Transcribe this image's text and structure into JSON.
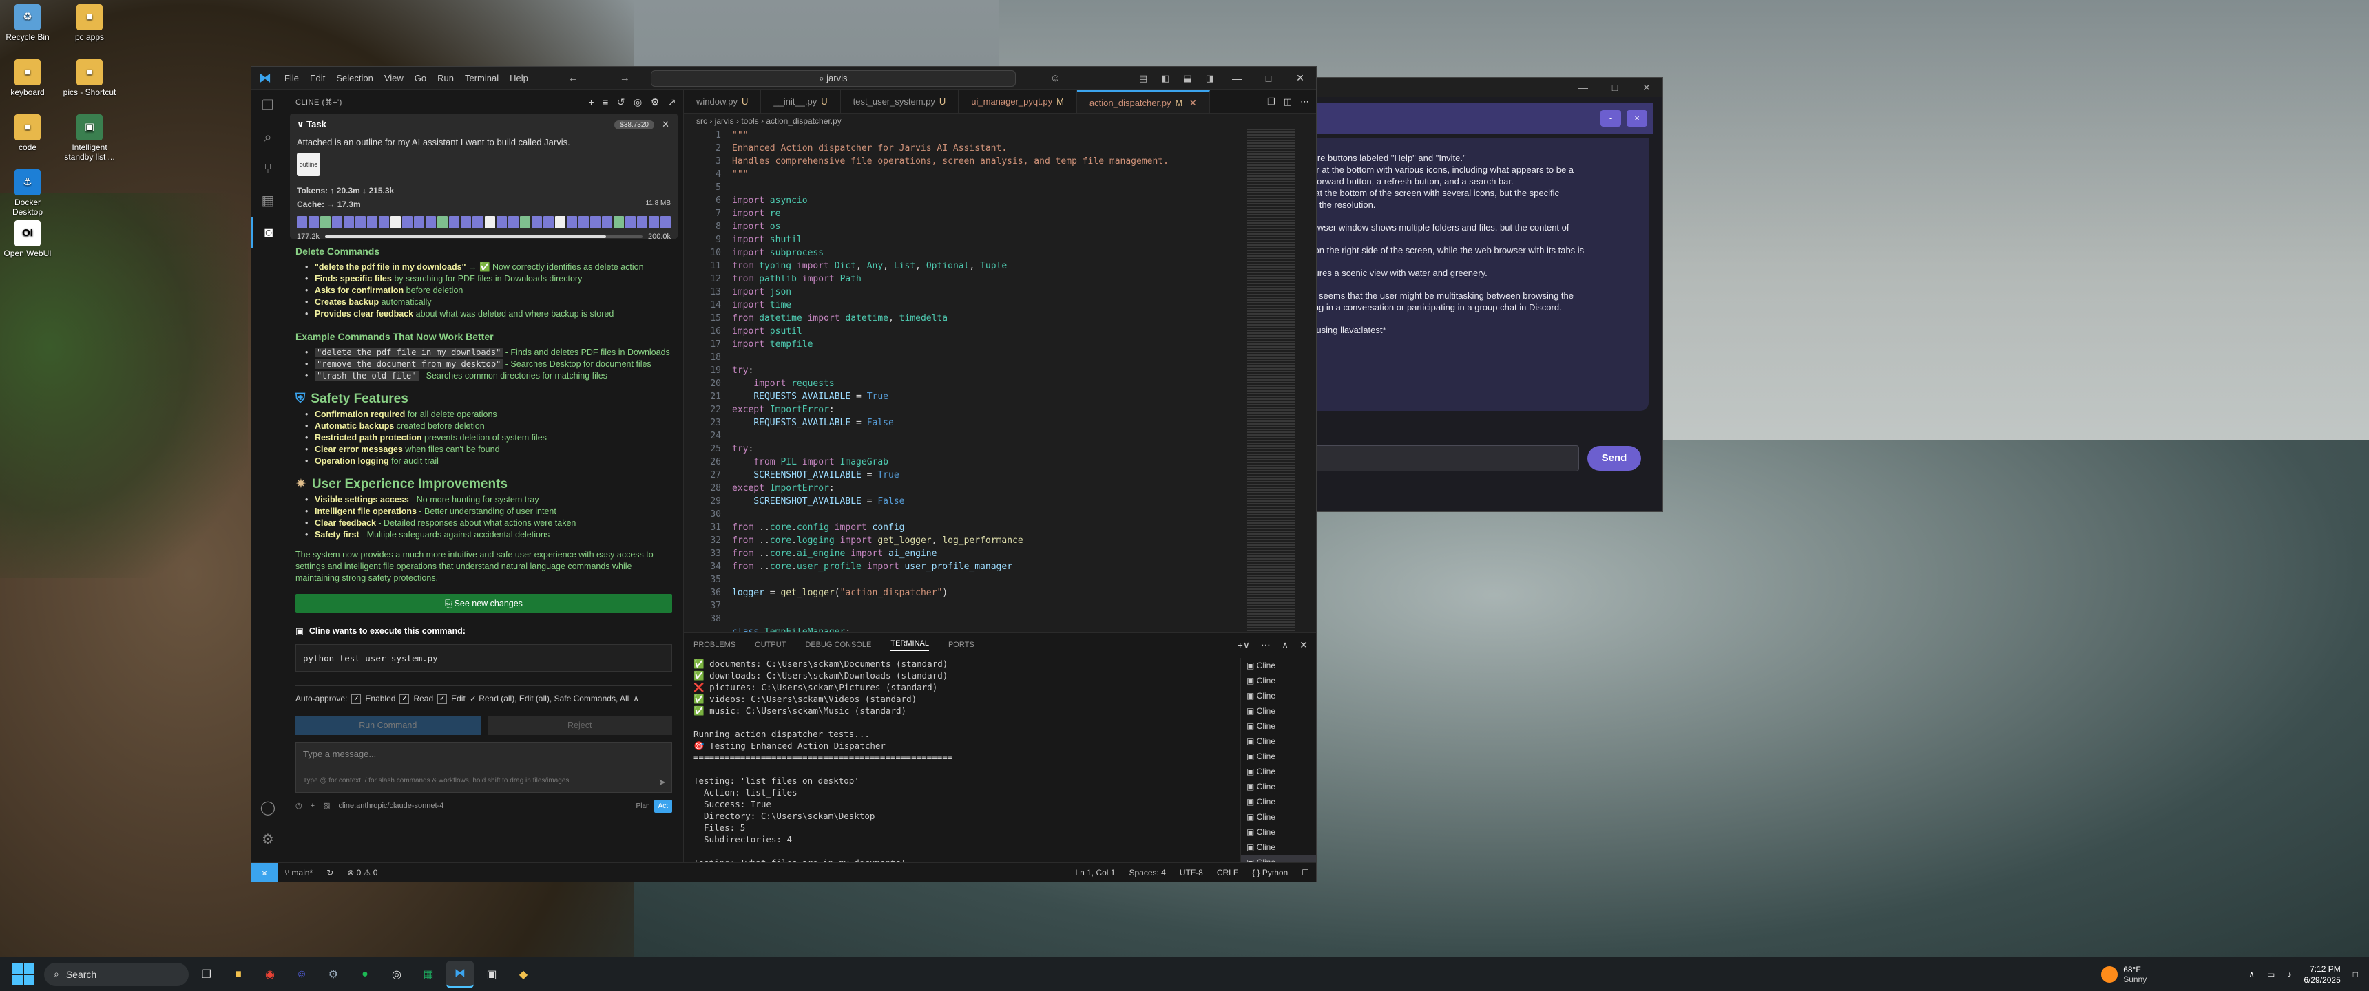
{
  "desktop": {
    "icons": [
      {
        "label": "Recycle Bin",
        "glyph": "♻",
        "color": "#5aa0d8"
      },
      {
        "label": "pc apps",
        "glyph": "■",
        "color": "#e8b84a"
      },
      {
        "label": "keyboard",
        "glyph": "■",
        "color": "#e8b84a"
      },
      {
        "label": "pics - Shortcut",
        "glyph": "■",
        "color": "#e8b84a"
      },
      {
        "label": "code",
        "glyph": "■",
        "color": "#e8b84a"
      },
      {
        "label": "Intelligent standby list ...",
        "glyph": "▣",
        "color": "#3a7f4f"
      },
      {
        "label": "Docker Desktop",
        "glyph": "⚓",
        "color": "#1d7fd6"
      },
      {
        "label": "Open WebUI",
        "glyph": "OI",
        "color": "#ffffff"
      }
    ]
  },
  "chatapp": {
    "window_controls": [
      "—",
      "□",
      "✕"
    ],
    "header_buttons": [
      "-",
      "×"
    ],
    "paragraphs": [
      "here are buttons labeled \"Help\" and \"Invite.\"\ntoolbar at the bottom with various icons, including what appears to be a\non, a forward button, a refresh button, and a search bar.\nisible at the bottom of the screen with several icons, but the specific\n due to the resolution.",
      "eb browser window shows multiple folders and files, but the content of",
      "open on the right side of the screen, while the web browser with its tabs is",
      "d features a scenic view with water and greenery.",
      "tent, it seems that the user might be multitasking between browsing the\nngaging in a conversation or participating in a group chat in Discord.",
      "64ms using llava:latest*"
    ],
    "send_label": "Send"
  },
  "vscode": {
    "menu": [
      "File",
      "Edit",
      "Selection",
      "View",
      "Go",
      "Run",
      "Terminal",
      "Help"
    ],
    "search_text": "⌕ jarvis",
    "window_controls": [
      "—",
      "□",
      "✕"
    ],
    "sidebar_title": "CLINE (⌘+')",
    "task": {
      "title": "Task",
      "badge": "$38.7320",
      "description": "Attached is an outline for my AI assistant I want to build called Jarvis.",
      "thumb_label": "outline",
      "tokens_label": "Tokens:",
      "tokens_value": "↑ 20.3m ↓ 215.3k",
      "cache_label": "Cache:",
      "cache_value": "→ 17.3m",
      "size": "11.8 MB",
      "context_used": "177.2k",
      "context_max": "200.0k",
      "context_fraction": 0.886
    },
    "content": {
      "delete_heading": "Delete Commands",
      "delete_items": [
        {
          "bold": "\"delete the pdf file in my downloads\"",
          "rest": " → ✅ Now correctly identifies as delete action"
        },
        {
          "bold": "Finds specific files",
          "rest": " by searching for PDF files in Downloads directory"
        },
        {
          "bold": "Asks for confirmation",
          "rest": " before deletion"
        },
        {
          "bold": "Creates backup",
          "rest": " automatically"
        },
        {
          "bold": "Provides clear feedback",
          "rest": " about what was deleted and where backup is stored"
        }
      ],
      "examples_heading": "Example Commands That Now Work Better",
      "examples": [
        {
          "code": "\"delete the pdf file in my downloads\"",
          "rest": " - Finds and deletes PDF files in Downloads"
        },
        {
          "code": "\"remove the document from my desktop\"",
          "rest": " - Searches Desktop for document files"
        },
        {
          "code": "\"trash the old file\"",
          "rest": " - Searches common directories for matching files"
        }
      ],
      "safety_heading": "Safety Features",
      "safety_items": [
        {
          "bold": "Confirmation required",
          "rest": " for all delete operations"
        },
        {
          "bold": "Automatic backups",
          "rest": " created before deletion"
        },
        {
          "bold": "Restricted path protection",
          "rest": " prevents deletion of system files"
        },
        {
          "bold": "Clear error messages",
          "rest": " when files can't be found"
        },
        {
          "bold": "Operation logging",
          "rest": " for audit trail"
        }
      ],
      "ux_heading": "User Experience Improvements",
      "ux_items": [
        {
          "bold": "Visible settings access",
          "rest": " - No more hunting for system tray"
        },
        {
          "bold": "Intelligent file operations",
          "rest": " - Better understanding of user intent"
        },
        {
          "bold": "Clear feedback",
          "rest": " - Detailed responses about what actions were taken"
        },
        {
          "bold": "Safety first",
          "rest": " - Multiple safeguards against accidental deletions"
        }
      ],
      "summary": "The system now provides a much more intuitive and safe user experience with easy access to settings and intelligent file operations that understand natural language commands while maintaining strong safety protections.",
      "see_changes": "See new changes",
      "exec_label": "Cline wants to execute this command:",
      "command": "python test_user_system.py",
      "auto_approve": "Auto-approve:",
      "enabled": "Enabled",
      "read": "Read",
      "edit": "Edit",
      "auto_summary": "✓ Read (all), Edit (all), Safe Commands, All",
      "run_command": "Run Command",
      "reject": "Reject",
      "placeholder": "Type a message...",
      "hint": "Type @ for context, / for slash commands & workflows, hold shift to drag in files/images",
      "model": "cline:anthropic/claude-sonnet-4",
      "plan": "Plan",
      "act": "Act"
    },
    "tabs": [
      {
        "label": "window.py",
        "mark": "U"
      },
      {
        "label": "__init__.py",
        "mark": "U"
      },
      {
        "label": "test_user_system.py",
        "mark": "U"
      },
      {
        "label": "ui_manager_pyqt.py",
        "mark": "M"
      },
      {
        "label": "action_dispatcher.py",
        "mark": "M"
      }
    ],
    "breadcrumbs": "src › jarvis › tools › action_dispatcher.py",
    "panel_tabs": [
      "PROBLEMS",
      "OUTPUT",
      "DEBUG CONSOLE",
      "TERMINAL",
      "PORTS"
    ],
    "terminal_lines": [
      "✅ documents: C:\\Users\\sckam\\Documents (standard)",
      "✅ downloads: C:\\Users\\sckam\\Downloads (standard)",
      "❌ pictures: C:\\Users\\sckam\\Pictures (standard)",
      "✅ videos: C:\\Users\\sckam\\Videos (standard)",
      "✅ music: C:\\Users\\sckam\\Music (standard)",
      "",
      "Running action dispatcher tests...",
      "🎯 Testing Enhanced Action Dispatcher",
      "==================================================",
      "",
      "Testing: 'list files on desktop'",
      "  Action: list_files",
      "  Success: True",
      "  Directory: C:\\Users\\sckam\\Desktop",
      "  Files: 5",
      "  Subdirectories: 4",
      "",
      "Testing: 'what files are in my documents'"
    ],
    "terminal_list": [
      "Cline",
      "Cline",
      "Cline",
      "Cline",
      "Cline",
      "Cline",
      "Cline",
      "Cline",
      "Cline",
      "Cline",
      "Cline",
      "Cline",
      "Cline",
      "Cline"
    ],
    "status": {
      "branch": "main*",
      "problems": "⊗ 0 ⚠ 0",
      "position": "Ln 1, Col 1",
      "spaces": "Spaces: 4",
      "encoding": "UTF-8",
      "eol": "CRLF",
      "lang": "{ } Python"
    }
  },
  "taskbar": {
    "search": "Search",
    "weather_temp": "68°F",
    "weather_desc": "Sunny",
    "time": "7:12 PM",
    "date": "6/29/2025"
  }
}
